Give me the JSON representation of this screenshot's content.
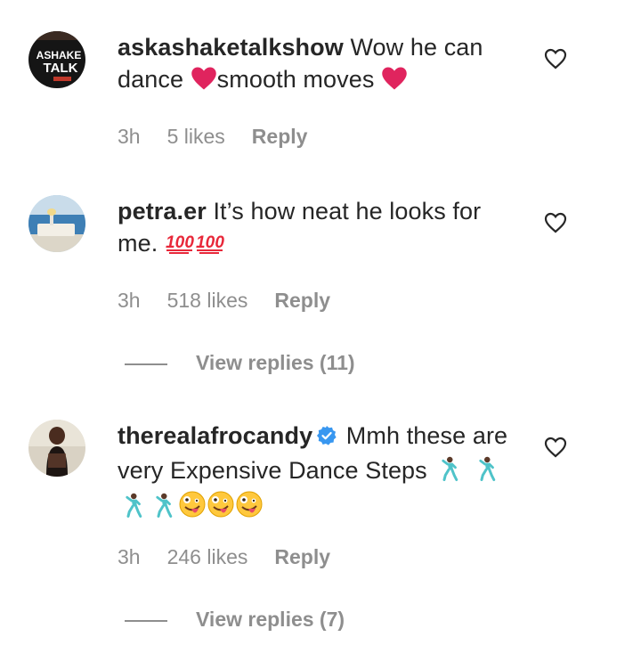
{
  "comments": [
    {
      "username": "askashaketalkshow",
      "text_part1": " Wow he can dance ",
      "text_part2": "smooth moves ",
      "time": "3h",
      "likes": "5 likes",
      "reply": "Reply",
      "avatar_text_1": "ASHAKE",
      "avatar_text_2": "TALK"
    },
    {
      "username": "petra.er",
      "text_part1": " It’s how neat he looks for me. ",
      "time": "3h",
      "likes": "518 likes",
      "reply": "Reply",
      "view_replies": "View replies (11)"
    },
    {
      "username": "therealafrocandy",
      "verified": true,
      "text_part1": " Mmh these are very Expensive Dance Steps ",
      "time": "3h",
      "likes": "246 likes",
      "reply": "Reply",
      "view_replies": "View replies (7)"
    }
  ],
  "icons": {
    "heart": "heart-outline-icon",
    "verified": "verified-badge-icon",
    "red_heart": "red-heart-emoji",
    "hundred": "hundred-points-emoji",
    "dancer": "man-dancing-emoji",
    "zany": "zany-face-emoji"
  },
  "colors": {
    "text": "#262626",
    "secondary": "#8e8e8e",
    "verified": "#3897f0",
    "heart_emoji": "#e0245e",
    "hundred_emoji": "#e8283a"
  }
}
